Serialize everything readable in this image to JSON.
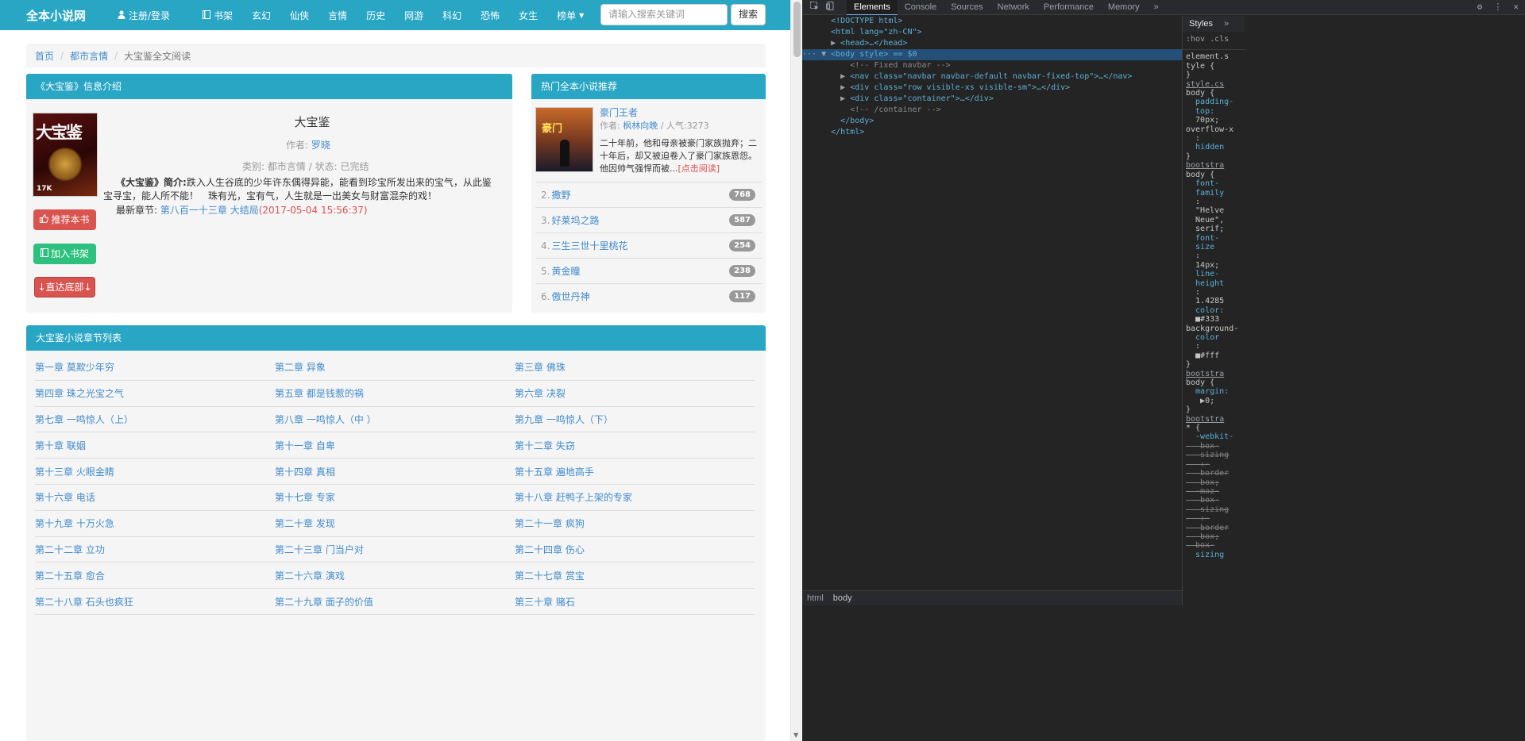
{
  "navbar": {
    "brand": "全本小说网",
    "login": "注册/登录",
    "items": [
      {
        "label": "书架",
        "icon": "book-icon"
      },
      {
        "label": "玄幻"
      },
      {
        "label": "仙侠"
      },
      {
        "label": "言情"
      },
      {
        "label": "历史"
      },
      {
        "label": "网游"
      },
      {
        "label": "科幻"
      },
      {
        "label": "恐怖"
      },
      {
        "label": "女生"
      },
      {
        "label": "榜单",
        "dropdown": true
      }
    ],
    "search_placeholder": "请输入搜索关键词",
    "search_button": "搜索",
    "color": "#28a6c4"
  },
  "breadcrumb": {
    "home": "首页",
    "category": "都市言情",
    "current": "大宝鉴全文阅读"
  },
  "info": {
    "heading": "《大宝鉴》信息介绍",
    "cover_text": "大宝鉴",
    "cover_logo": "17K",
    "title": "大宝鉴",
    "author_label": "作者:",
    "author": "罗晓",
    "category_label": "类别:",
    "category": "都市言情",
    "status_label": "/ 状态:",
    "status": "已完结",
    "intro_label": "《大宝鉴》简介:",
    "intro": "跌入人生谷底的少年许东偶得异能，能看到珍宝所发出来的宝气，从此鉴宝寻宝，能人所不能！　珠有光，宝有气，人生就是一出美女与财富混杂的戏！",
    "latest_label": "最新章节:",
    "latest_chapter": "第八百一十三章 大结局",
    "latest_date": "(2017-05-04 15:56:37)",
    "btn_recommend": "推荐本书",
    "btn_shelf": "加入书架",
    "btn_bottom": "↓直达底部↓"
  },
  "hot": {
    "heading": "热门全本小说推荐",
    "top": {
      "title": "豪门王者",
      "cover_text": "豪门",
      "author_label": "作者:",
      "author": "枫林向晚",
      "popularity": "/ 人气:3273",
      "desc": "二十年前，他和母亲被豪门家族抛弃；二十年后，却又被迫卷入了豪门家族恩怨。他因帅气强悍而被...",
      "readmore": "[点击阅读]"
    },
    "ranks": [
      {
        "num": "2.",
        "name": "撒野",
        "count": "768"
      },
      {
        "num": "3.",
        "name": "好莱坞之路",
        "count": "587"
      },
      {
        "num": "4.",
        "name": "三生三世十里桃花",
        "count": "254"
      },
      {
        "num": "5.",
        "name": "黄金瞳",
        "count": "238"
      },
      {
        "num": "6.",
        "name": "傲世丹神",
        "count": "117"
      }
    ]
  },
  "chapters": {
    "heading": "大宝鉴小说章节列表",
    "rows": [
      [
        "第一章 莫欺少年穷",
        "第二章 异象",
        "第三章 佛珠"
      ],
      [
        "第四章 珠之光宝之气",
        "第五章 都是钱惹的祸",
        "第六章 决裂"
      ],
      [
        "第七章 一鸣惊人（上）",
        "第八章 一鸣惊人（中 ）",
        "第九章 一鸣惊人（下）"
      ],
      [
        "第十章 联姻",
        "第十一章 自卑",
        "第十二章 失窃"
      ],
      [
        "第十三章 火眼金睛",
        "第十四章 真相",
        "第十五章 遍地高手"
      ],
      [
        "第十六章 电话",
        "第十七章 专家",
        "第十八章 赶鸭子上架的专家"
      ],
      [
        "第十九章 十万火急",
        "第二十章 发现",
        "第二十一章 疯狗"
      ],
      [
        "第二十二章 立功",
        "第二十三章 门当户对",
        "第二十四章 伤心"
      ],
      [
        "第二十五章 愈合",
        "第二十六章 演戏",
        "第二十七章 赏宝"
      ],
      [
        "第二十八章 石头也疯狂",
        "第二十九章 面子的价值",
        "第三十章 赌石"
      ]
    ]
  },
  "devtools": {
    "tabs": [
      "Elements",
      "Console",
      "Sources",
      "Network",
      "Performance",
      "Memory"
    ],
    "more_tabs": "»",
    "dom": [
      {
        "kind": "text",
        "text": "<!DOCTYPE html>"
      },
      {
        "kind": "open",
        "text": "<html lang=\"zh-CN\">"
      },
      {
        "kind": "collapsed",
        "text": "<head>…</head>"
      },
      {
        "kind": "selected",
        "text": "<body style> == $0"
      },
      {
        "kind": "comment",
        "text": "<!-- Fixed navbar -->"
      },
      {
        "kind": "collapsed",
        "text": "<nav class=\"navbar navbar-default navbar-fixed-top\">…</nav>"
      },
      {
        "kind": "collapsed",
        "text": "<div class=\"row visible-xs visible-sm\">…</div>"
      },
      {
        "kind": "collapsed",
        "text": "<div class=\"container\">…</div>"
      },
      {
        "kind": "comment",
        "text": "<!-- /container -->"
      },
      {
        "kind": "close",
        "text": "</body>"
      },
      {
        "kind": "close",
        "text": "</html>"
      }
    ],
    "crumbs": [
      "html",
      "body"
    ],
    "styles_tab": "Styles",
    "styles_more": "»",
    "styles_filter": ":hov .cls",
    "styles": [
      "element.s",
      "tyle {",
      "}",
      "style.cs",
      "body {",
      "  padding-",
      "  top:",
      "  70px;",
      "",
      "overflow-x",
      "  :",
      "  hidden",
      "}",
      "bootstra",
      "body {",
      "  font-",
      "  family",
      "  :",
      "  \"Helve",
      "  Neue\",",
      "  serif;",
      "  font-",
      "  size",
      "  :",
      "  14px;",
      "  line-",
      "  height",
      "  :",
      "  1.4285",
      "  color:",
      "  ■#333",
      "",
      "background-",
      "  color",
      "  :",
      "  ■#fff",
      "}",
      "bootstra",
      "body {",
      "  margin:",
      "   ▶0;",
      "}",
      "bootstra",
      "* {",
      "  -webkit-",
      "   box-",
      "   sizing",
      "   :-",
      "   border",
      "   box;",
      "  -moz-",
      "   box-",
      "   sizing",
      "   :-",
      "   border",
      "   box;",
      "  box-",
      "  sizing"
    ]
  }
}
